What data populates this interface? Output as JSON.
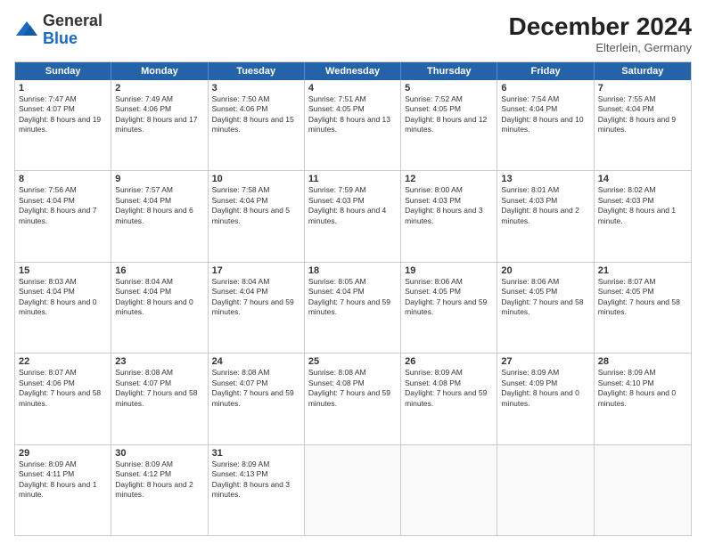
{
  "logo": {
    "general": "General",
    "blue": "Blue"
  },
  "header": {
    "month": "December 2024",
    "location": "Elterlein, Germany"
  },
  "days_of_week": [
    "Sunday",
    "Monday",
    "Tuesday",
    "Wednesday",
    "Thursday",
    "Friday",
    "Saturday"
  ],
  "weeks": [
    [
      {
        "day": "1",
        "info": "Sunrise: 7:47 AM\nSunset: 4:07 PM\nDaylight: 8 hours and 19 minutes."
      },
      {
        "day": "2",
        "info": "Sunrise: 7:49 AM\nSunset: 4:06 PM\nDaylight: 8 hours and 17 minutes."
      },
      {
        "day": "3",
        "info": "Sunrise: 7:50 AM\nSunset: 4:06 PM\nDaylight: 8 hours and 15 minutes."
      },
      {
        "day": "4",
        "info": "Sunrise: 7:51 AM\nSunset: 4:05 PM\nDaylight: 8 hours and 13 minutes."
      },
      {
        "day": "5",
        "info": "Sunrise: 7:52 AM\nSunset: 4:05 PM\nDaylight: 8 hours and 12 minutes."
      },
      {
        "day": "6",
        "info": "Sunrise: 7:54 AM\nSunset: 4:04 PM\nDaylight: 8 hours and 10 minutes."
      },
      {
        "day": "7",
        "info": "Sunrise: 7:55 AM\nSunset: 4:04 PM\nDaylight: 8 hours and 9 minutes."
      }
    ],
    [
      {
        "day": "8",
        "info": "Sunrise: 7:56 AM\nSunset: 4:04 PM\nDaylight: 8 hours and 7 minutes."
      },
      {
        "day": "9",
        "info": "Sunrise: 7:57 AM\nSunset: 4:04 PM\nDaylight: 8 hours and 6 minutes."
      },
      {
        "day": "10",
        "info": "Sunrise: 7:58 AM\nSunset: 4:04 PM\nDaylight: 8 hours and 5 minutes."
      },
      {
        "day": "11",
        "info": "Sunrise: 7:59 AM\nSunset: 4:03 PM\nDaylight: 8 hours and 4 minutes."
      },
      {
        "day": "12",
        "info": "Sunrise: 8:00 AM\nSunset: 4:03 PM\nDaylight: 8 hours and 3 minutes."
      },
      {
        "day": "13",
        "info": "Sunrise: 8:01 AM\nSunset: 4:03 PM\nDaylight: 8 hours and 2 minutes."
      },
      {
        "day": "14",
        "info": "Sunrise: 8:02 AM\nSunset: 4:03 PM\nDaylight: 8 hours and 1 minute."
      }
    ],
    [
      {
        "day": "15",
        "info": "Sunrise: 8:03 AM\nSunset: 4:04 PM\nDaylight: 8 hours and 0 minutes."
      },
      {
        "day": "16",
        "info": "Sunrise: 8:04 AM\nSunset: 4:04 PM\nDaylight: 8 hours and 0 minutes."
      },
      {
        "day": "17",
        "info": "Sunrise: 8:04 AM\nSunset: 4:04 PM\nDaylight: 7 hours and 59 minutes."
      },
      {
        "day": "18",
        "info": "Sunrise: 8:05 AM\nSunset: 4:04 PM\nDaylight: 7 hours and 59 minutes."
      },
      {
        "day": "19",
        "info": "Sunrise: 8:06 AM\nSunset: 4:05 PM\nDaylight: 7 hours and 59 minutes."
      },
      {
        "day": "20",
        "info": "Sunrise: 8:06 AM\nSunset: 4:05 PM\nDaylight: 7 hours and 58 minutes."
      },
      {
        "day": "21",
        "info": "Sunrise: 8:07 AM\nSunset: 4:05 PM\nDaylight: 7 hours and 58 minutes."
      }
    ],
    [
      {
        "day": "22",
        "info": "Sunrise: 8:07 AM\nSunset: 4:06 PM\nDaylight: 7 hours and 58 minutes."
      },
      {
        "day": "23",
        "info": "Sunrise: 8:08 AM\nSunset: 4:07 PM\nDaylight: 7 hours and 58 minutes."
      },
      {
        "day": "24",
        "info": "Sunrise: 8:08 AM\nSunset: 4:07 PM\nDaylight: 7 hours and 59 minutes."
      },
      {
        "day": "25",
        "info": "Sunrise: 8:08 AM\nSunset: 4:08 PM\nDaylight: 7 hours and 59 minutes."
      },
      {
        "day": "26",
        "info": "Sunrise: 8:09 AM\nSunset: 4:08 PM\nDaylight: 7 hours and 59 minutes."
      },
      {
        "day": "27",
        "info": "Sunrise: 8:09 AM\nSunset: 4:09 PM\nDaylight: 8 hours and 0 minutes."
      },
      {
        "day": "28",
        "info": "Sunrise: 8:09 AM\nSunset: 4:10 PM\nDaylight: 8 hours and 0 minutes."
      }
    ],
    [
      {
        "day": "29",
        "info": "Sunrise: 8:09 AM\nSunset: 4:11 PM\nDaylight: 8 hours and 1 minute."
      },
      {
        "day": "30",
        "info": "Sunrise: 8:09 AM\nSunset: 4:12 PM\nDaylight: 8 hours and 2 minutes."
      },
      {
        "day": "31",
        "info": "Sunrise: 8:09 AM\nSunset: 4:13 PM\nDaylight: 8 hours and 3 minutes."
      },
      {
        "day": "",
        "info": ""
      },
      {
        "day": "",
        "info": ""
      },
      {
        "day": "",
        "info": ""
      },
      {
        "day": "",
        "info": ""
      }
    ]
  ]
}
